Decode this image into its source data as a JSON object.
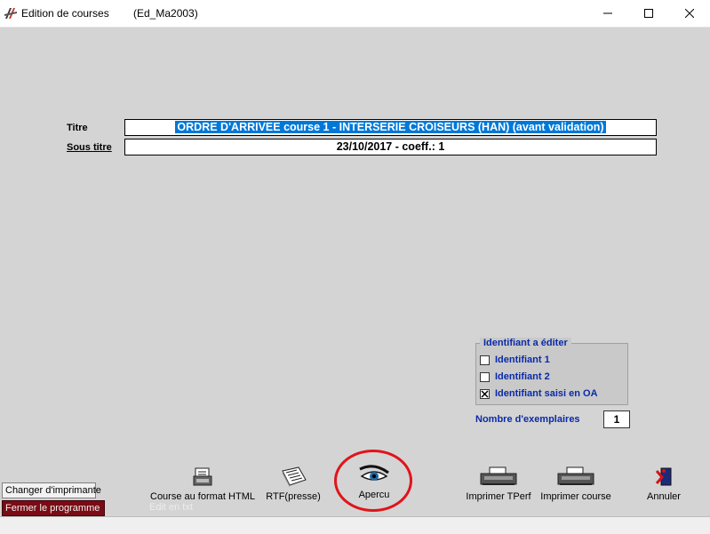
{
  "window": {
    "title": "Edition de courses",
    "subtitle": "(Ed_Ma2003)"
  },
  "form": {
    "titre_label": "Titre",
    "titre_value": "ORDRE D'ARRIVEE course 1 - INTERSERIE CROISEURS (HAN) (avant validation)",
    "sous_titre_label": "Sous titre",
    "sous_titre_value": "23/10/2017 - coeff.: 1"
  },
  "identifiant": {
    "group_title": "Identifiant a éditer",
    "options": [
      {
        "label": "Identifiant 1",
        "checked": false
      },
      {
        "label": "Identifiant 2",
        "checked": false
      },
      {
        "label": "Identifiant saisi en OA",
        "checked": true
      }
    ]
  },
  "copies": {
    "label": "Nombre d'exemplaires",
    "value": "1"
  },
  "toolbar": {
    "html_label": "Course au format HTML",
    "rtf_label": "RTF(presse)",
    "apercu_label": "Apercu",
    "tperf_label": "Imprimer TPerf",
    "course_label": "Imprimer course",
    "annuler_label": "Annuler"
  },
  "bottom": {
    "changer_label": "Changer d'imprimante",
    "fermer_label": "Fermer le programme",
    "faint_label": "Edit en txt"
  },
  "colors": {
    "background": "#d4d4d4",
    "accent_blue": "#0a2aa8",
    "selection": "#0078d7",
    "highlight_circle": "#e0141b",
    "fermer_bg": "#7a0b14"
  }
}
